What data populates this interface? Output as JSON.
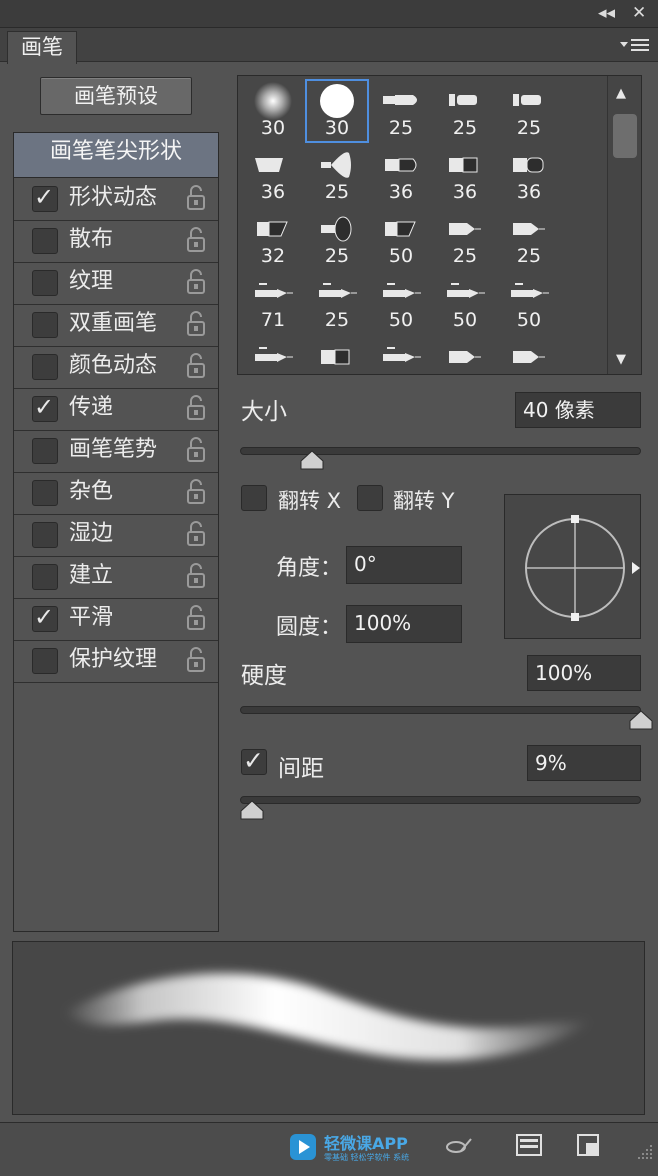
{
  "window": {
    "collapse_icon": "double-chevron-left-icon",
    "close_icon": "close-icon",
    "collapse_glyph": "◂◂",
    "close_glyph": "✕"
  },
  "tab": {
    "label": "画笔",
    "menu_icon": "panel-menu-icon"
  },
  "presets_button": "画笔预设",
  "brush_tip_header": "画笔笔尖形状",
  "options": [
    {
      "label": "形状动态",
      "checked": true
    },
    {
      "label": "散布",
      "checked": false
    },
    {
      "label": "纹理",
      "checked": false
    },
    {
      "label": "双重画笔",
      "checked": false
    },
    {
      "label": "颜色动态",
      "checked": false
    },
    {
      "label": "传递",
      "checked": true
    },
    {
      "label": "画笔笔势",
      "checked": false
    },
    {
      "label": "杂色",
      "checked": false
    },
    {
      "label": "湿边",
      "checked": false
    },
    {
      "label": "建立",
      "checked": false
    },
    {
      "label": "平滑",
      "checked": true
    },
    {
      "label": "保护纹理",
      "checked": false
    }
  ],
  "brush_grid": {
    "selected_index": 1,
    "sizes": [
      [
        "30",
        "30",
        "25",
        "25",
        "25"
      ],
      [
        "36",
        "25",
        "36",
        "36",
        "36"
      ],
      [
        "32",
        "25",
        "50",
        "25",
        "25"
      ],
      [
        "71",
        "25",
        "50",
        "50",
        "50"
      ],
      [
        "",
        "",
        "",
        "",
        ""
      ]
    ]
  },
  "size": {
    "label": "大小",
    "value": "40 像素",
    "fraction": 0.18
  },
  "flip_x": {
    "label": "翻转 X",
    "checked": false
  },
  "flip_y": {
    "label": "翻转 Y",
    "checked": false
  },
  "angle": {
    "label": "角度：",
    "value": "0°"
  },
  "roundness": {
    "label": "圆度：",
    "value": "100%"
  },
  "hardness": {
    "label": "硬度",
    "value": "100%",
    "fraction": 1.0
  },
  "spacing": {
    "label": "间距",
    "value": "9%",
    "checked": true,
    "fraction": 0.03
  },
  "tick_glyph": "✓",
  "footer": {
    "brand_name": "轻微课APP",
    "brand_sub": "零基础 轻松学软件 系统",
    "icons": [
      "brush-toggle-icon",
      "grid-panel-icon",
      "new-brush-icon"
    ]
  }
}
